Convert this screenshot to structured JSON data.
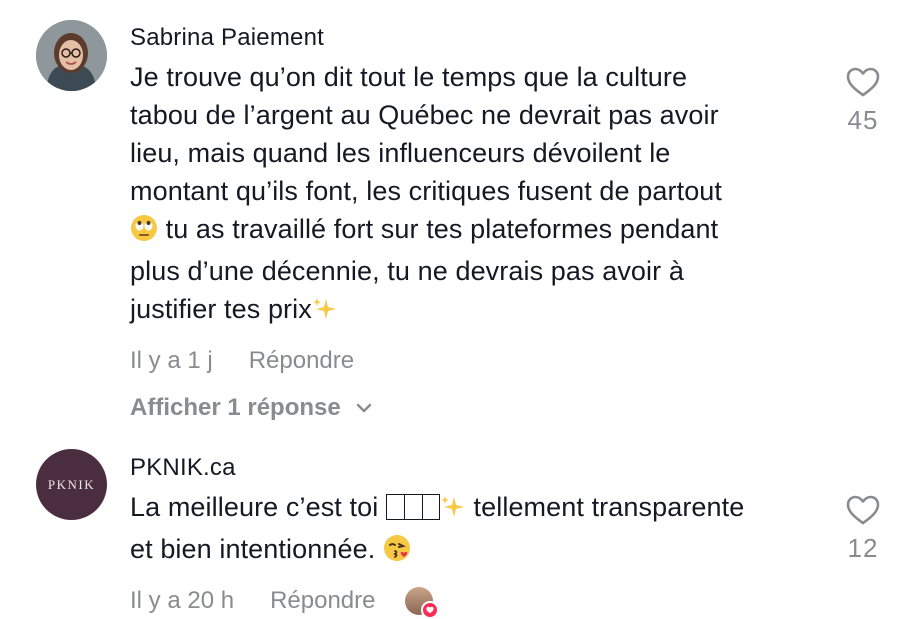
{
  "comments": [
    {
      "username": "Sabrina Paiement",
      "avatar_icon": "profile-photo-woman-glasses",
      "lines": [
        "Je trouve qu’on dit tout le temps que la culture",
        "tabou de l’argent au Québec ne devrait pas avoir",
        "lieu, mais quand les influenceurs dévoilent le",
        "montant qu’ils font, les critiques fusent de partout",
        " tu as travaillé fort sur tes plateformes pendant",
        "plus d’une décennie, tu ne devrais pas avoir à",
        "justifier tes prix"
      ],
      "time": "Il y a 1 j",
      "reply_label": "Répondre",
      "likes": "45",
      "show_replies_label": "Afficher 1 réponse"
    },
    {
      "username": "PKNIK.ca",
      "avatar_label": "PKNIK",
      "line1_a": "La meilleure c’est toi ",
      "line1_b": " tellement transparente",
      "line2": "et bien intentionnée. ",
      "time": "Il y a 20 h",
      "reply_label": "Répondre",
      "likes": "12"
    }
  ],
  "colors": {
    "text": "#161823",
    "muted": "#8a8b91",
    "brand_avatar": "#4a2e40",
    "like_badge": "#fe2c55"
  }
}
